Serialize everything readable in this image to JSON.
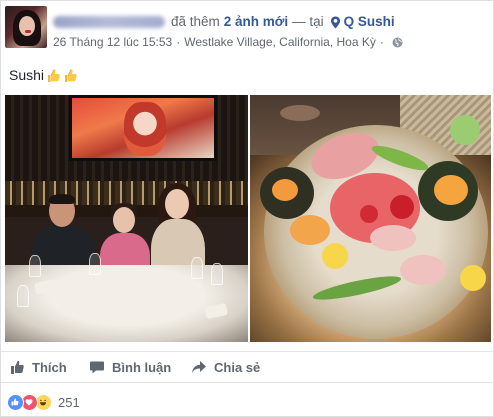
{
  "header": {
    "action_text": "đã thêm",
    "photos_link": "2 ảnh mới",
    "at_text": "— tại",
    "place": "Q Sushi",
    "date": "26 Tháng 12 lúc 15:53",
    "separator": "·",
    "location": "Westlake Village, California, Hoa Kỳ"
  },
  "caption": {
    "text": "Sushi"
  },
  "icons": {
    "place": "map-pin-icon",
    "privacy": "globe-icon",
    "caption_emoji": "thumbs-up-emoji-icon"
  },
  "actions": {
    "like": "Thích",
    "comment": "Bình luận",
    "share": "Chia sẻ"
  },
  "reactions": {
    "count": "251",
    "types": [
      "like",
      "love",
      "haha"
    ]
  },
  "colors": {
    "link": "#365899",
    "muted": "#616770",
    "like_blue": "#5890ff",
    "love_red": "#f25268",
    "haha_yellow": "#fdd65b"
  }
}
